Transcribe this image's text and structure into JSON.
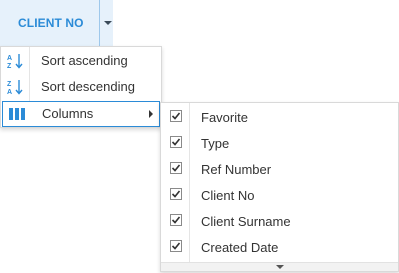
{
  "header": {
    "column_title": "CLIENT NO"
  },
  "menu": {
    "items": [
      {
        "label": "Sort ascending",
        "icon": "sort-ascending-icon"
      },
      {
        "label": "Sort descending",
        "icon": "sort-descending-icon"
      },
      {
        "label": "Columns",
        "icon": "columns-icon"
      }
    ]
  },
  "columns_submenu": {
    "items": [
      {
        "label": "Favorite",
        "checked": true
      },
      {
        "label": "Type",
        "checked": true
      },
      {
        "label": "Ref Number",
        "checked": true
      },
      {
        "label": "Client No",
        "checked": true
      },
      {
        "label": "Client Surname",
        "checked": true
      },
      {
        "label": "Created Date",
        "checked": true
      }
    ]
  },
  "colors": {
    "accent": "#2b8bd7",
    "header_bg": "#e6f1fb",
    "checkbox_check": "#333333"
  }
}
